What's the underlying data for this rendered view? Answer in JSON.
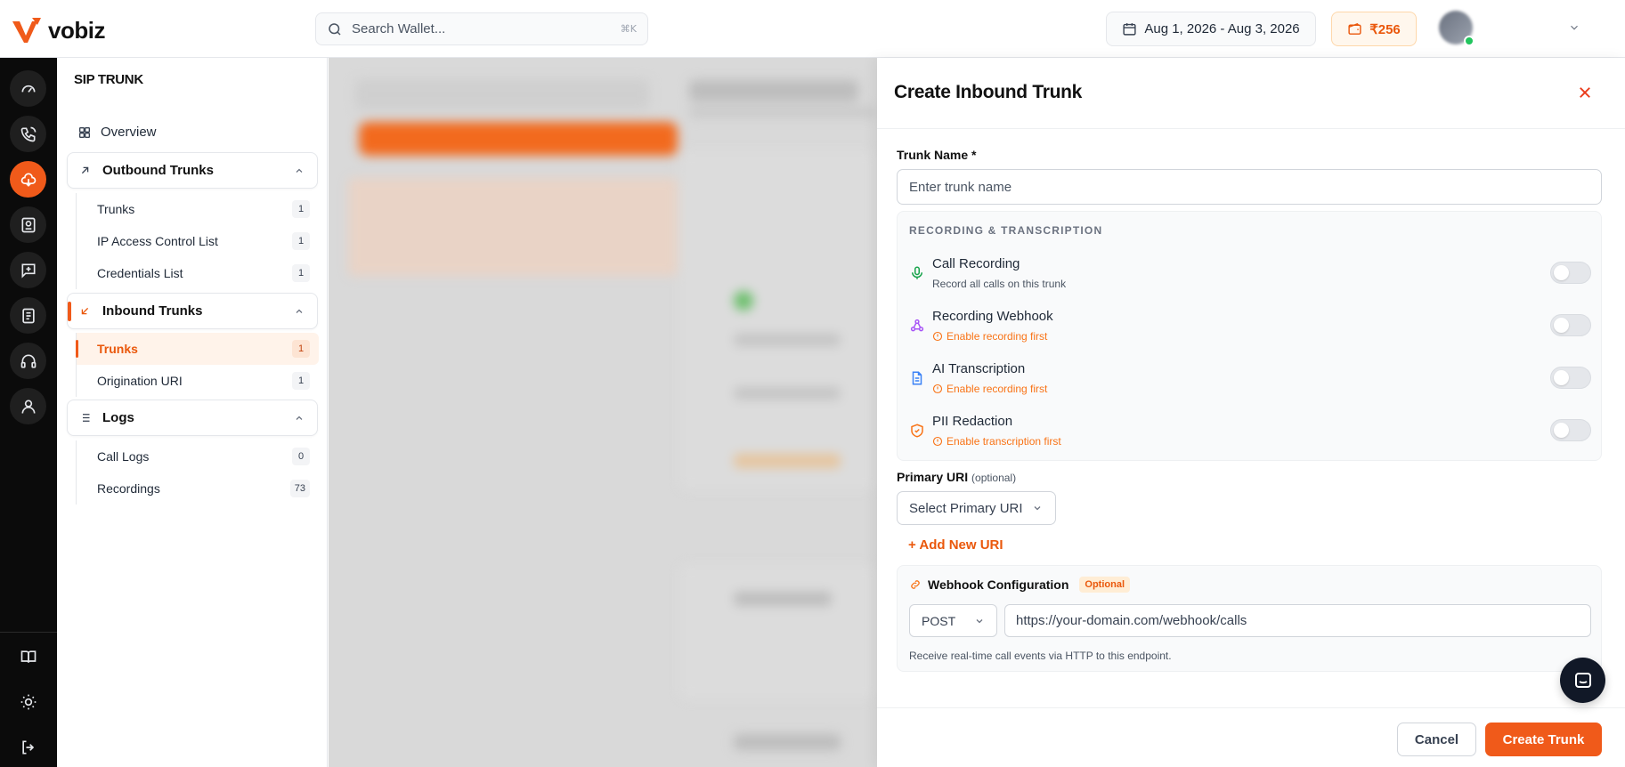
{
  "header": {
    "brand": "vobiz",
    "search_placeholder": "Search Wallet...",
    "search_shortcut": "⌘K",
    "date_range": "Aug 1, 2026 - Aug 3, 2026",
    "wallet_balance": "₹256"
  },
  "rail": {
    "icons": [
      "dashboard-icon",
      "phone-icon",
      "sip-cloud-icon",
      "contact-card-icon",
      "message-plus-icon",
      "billing-icon",
      "headset-icon",
      "user-icon",
      "book-icon",
      "sun-icon",
      "logout-icon"
    ],
    "active": "sip-cloud-icon"
  },
  "sidebar": {
    "section_title": "SIP TRUNK",
    "overview": "Overview",
    "outbound": {
      "label": "Outbound Trunks",
      "items": [
        {
          "label": "Trunks",
          "count": "1"
        },
        {
          "label": "IP Access Control List",
          "count": "1"
        },
        {
          "label": "Credentials List",
          "count": "1"
        }
      ]
    },
    "inbound": {
      "label": "Inbound Trunks",
      "items": [
        {
          "label": "Trunks",
          "count": "1"
        },
        {
          "label": "Origination URI",
          "count": "1"
        }
      ]
    },
    "logs": {
      "label": "Logs",
      "items": [
        {
          "label": "Call Logs",
          "count": "0"
        },
        {
          "label": "Recordings",
          "count": "73"
        }
      ]
    }
  },
  "drawer": {
    "title": "Create Inbound Trunk",
    "trunk_name_label": "Trunk Name *",
    "trunk_name_placeholder": "Enter trunk name",
    "section_title": "RECORDING & TRANSCRIPTION",
    "options": [
      {
        "label": "Call Recording",
        "sub": "Record all calls on this trunk",
        "enabled": false
      },
      {
        "label": "Recording Webhook",
        "sub": "Enable recording first",
        "enabled": false
      },
      {
        "label": "AI Transcription",
        "sub": "Enable recording first",
        "enabled": false
      },
      {
        "label": "PII Redaction",
        "sub": "Enable transcription first",
        "enabled": false
      }
    ],
    "primary_uri_label": "Primary URI",
    "primary_uri_optional": "(optional)",
    "primary_uri_select": "Select Primary URI",
    "add_uri": "+ Add New URI",
    "webhook": {
      "title": "Webhook Configuration",
      "badge": "Optional",
      "method": "POST",
      "url_placeholder": "https://your-domain.com/webhook/calls",
      "help": "Receive real-time call events via HTTP to this endpoint."
    },
    "cancel": "Cancel",
    "create": "Create Trunk"
  },
  "colors": {
    "accent": "#f05a1a",
    "warning": "#f97316",
    "rail_bg": "#0b0b0b"
  }
}
